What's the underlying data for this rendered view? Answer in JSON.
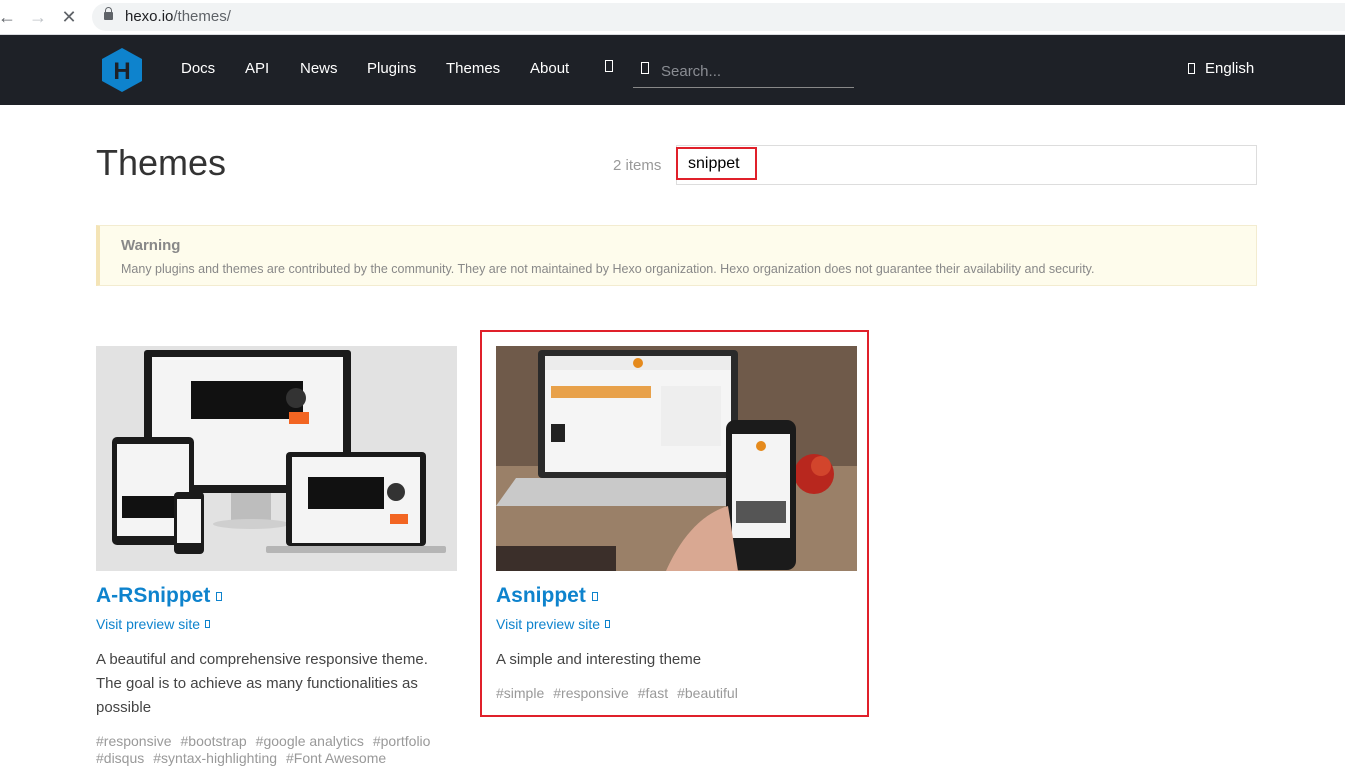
{
  "browser": {
    "url_host": "hexo.io",
    "url_path": "/themes/",
    "icons": [
      "back-arrow-icon",
      "forward-arrow-icon",
      "close-icon",
      "lock-icon"
    ]
  },
  "header": {
    "logo_letter": "H",
    "nav": [
      "Docs",
      "API",
      "News",
      "Plugins",
      "Themes",
      "About"
    ],
    "search_placeholder": "Search...",
    "language": "English"
  },
  "page": {
    "title": "Themes",
    "count": "2 items",
    "filter_value": "snippet"
  },
  "warning": {
    "title": "Warning",
    "text": "Many plugins and themes are contributed by the community. They are not maintained by Hexo organization. Hexo organization does not guarantee their availability and security."
  },
  "themes": [
    {
      "name": "A-RSnippet",
      "preview": "Visit preview site",
      "description": "A beautiful and comprehensive responsive theme. The goal is to achieve as many functionalities as possible",
      "tags_line1": [
        "#responsive",
        "#bootstrap",
        "#google analytics",
        "#portfolio"
      ],
      "tags_line2": [
        "#disqus",
        "#syntax-highlighting",
        "#Font Awesome"
      ]
    },
    {
      "name": "Asnippet",
      "preview": "Visit preview site",
      "description": "A simple and interesting theme",
      "tags_line1": [
        "#simple",
        "#responsive",
        "#fast",
        "#beautiful"
      ]
    }
  ],
  "colors": {
    "header_bg": "#1e2127",
    "link": "#0e83cd",
    "highlight": "#e0202a",
    "logo": "#0e83cd"
  }
}
